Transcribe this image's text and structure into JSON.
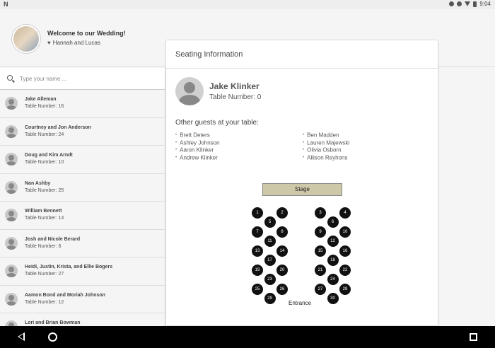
{
  "status_bar": {
    "logo": "N",
    "time": "9:04"
  },
  "header": {
    "title": "Welcome to our Wedding!",
    "subtitle": "Hannah and Lucas"
  },
  "search": {
    "placeholder": "Type your name ..."
  },
  "guests": [
    {
      "name": "Jake Alleman",
      "table": "Table Number: 16"
    },
    {
      "name": "Courtney and Jon Anderson",
      "table": "Table Number: 24"
    },
    {
      "name": "Doug and Kim Arndt",
      "table": "Table Number: 10"
    },
    {
      "name": "Nan Ashby",
      "table": "Table Number: 25"
    },
    {
      "name": "William Bennett",
      "table": "Table Number: 14"
    },
    {
      "name": "Josh and Nicole Berard",
      "table": "Table Number: 6"
    },
    {
      "name": "Heidi, Justin, Krista, and Ellie Bogers",
      "table": "Table Number: 27"
    },
    {
      "name": "Aamon Bond and Moriah Johnson",
      "table": "Table Number: 12"
    },
    {
      "name": "Lori and Brian Bowman",
      "table": "Table Number: 7"
    }
  ],
  "seating": {
    "title": "Seating Information",
    "selected_name": "Jake Klinker",
    "selected_table": "Table Number: 0",
    "others_title": "Other guests at your table:",
    "others_left": [
      "Brett Deters",
      "Ashley Johnson",
      "Aaron Klinker",
      "Andrew Klinker"
    ],
    "others_right": [
      "Ben Madden",
      "Lauren Majewski",
      "Olivia Osborn",
      "Allison Reyhons"
    ],
    "stage_label": "Stage",
    "entrance_label": "Entrance",
    "tables_left": [
      "1",
      "2",
      "5",
      "7",
      "8",
      "11",
      "13",
      "14",
      "17",
      "19",
      "20",
      "23",
      "25",
      "26",
      "29"
    ],
    "tables_right": [
      "3",
      "4",
      "6",
      "9",
      "10",
      "12",
      "15",
      "16",
      "18",
      "21",
      "22",
      "24",
      "27",
      "28",
      "30"
    ]
  },
  "colors": {
    "stage": "#cdc8a8",
    "table": "#111111"
  }
}
